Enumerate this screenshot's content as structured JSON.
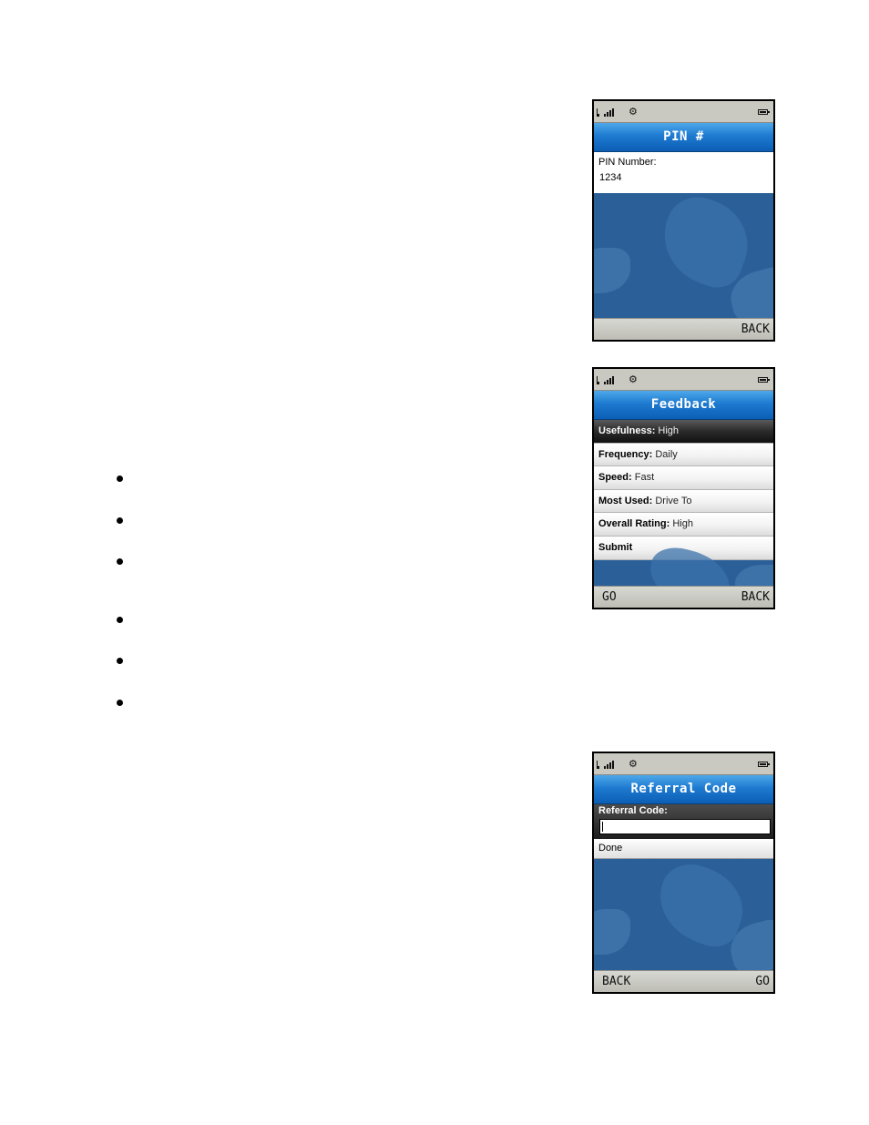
{
  "pin_screen": {
    "title": "PIN #",
    "field_label": "PIN Number:",
    "field_value": "1234",
    "softkey_right": "BACK"
  },
  "feedback_screen": {
    "title": "Feedback",
    "items": [
      {
        "label": "Usefulness:",
        "value": "High"
      },
      {
        "label": "Frequency:",
        "value": "Daily"
      },
      {
        "label": "Speed:",
        "value": "Fast"
      },
      {
        "label": "Most Used:",
        "value": "Drive To"
      },
      {
        "label": "Overall Rating:",
        "value": "High"
      },
      {
        "label": "Submit",
        "value": ""
      }
    ],
    "selected_index": 0,
    "softkey_left": "GO",
    "softkey_right": "BACK"
  },
  "referral_screen": {
    "title": "Referral Code",
    "field_label": "Referral Code:",
    "field_value": "",
    "done_label": "Done",
    "softkey_left": "BACK",
    "softkey_right": "GO"
  },
  "colors": {
    "title_bar": "#1e7ad0",
    "background": "#2b5f97",
    "softkey_bar": "#c9c9c1",
    "selected_item": "#2a2a2a"
  },
  "icons": [
    "signal-icon",
    "settings-gear-icon",
    "battery-icon"
  ],
  "bullet_count": 6
}
